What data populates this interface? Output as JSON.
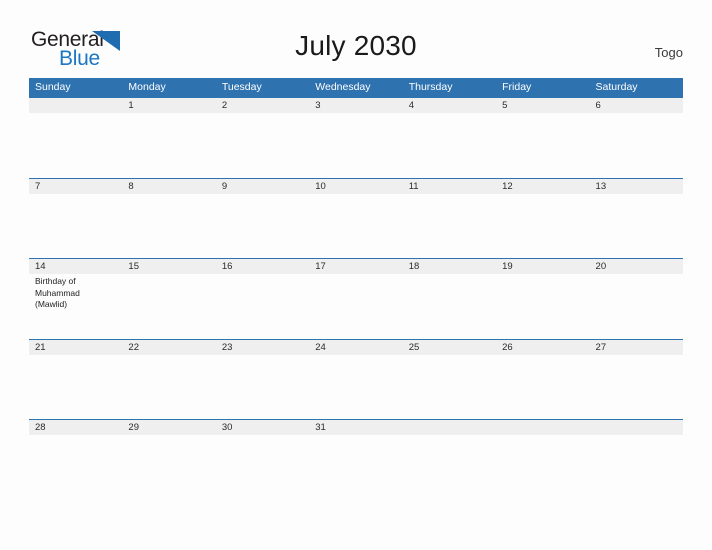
{
  "brand": {
    "word_one": "General",
    "word_two": "Blue",
    "triangle_icon": "triangle-icon",
    "accent_blue": "#1b76c4",
    "logo_dark": "#231f20"
  },
  "header": {
    "title": "July 2030",
    "country": "Togo"
  },
  "calendar": {
    "header_blue": "#2f72b0",
    "band_gray": "#efefef",
    "weekdays": [
      "Sunday",
      "Monday",
      "Tuesday",
      "Wednesday",
      "Thursday",
      "Friday",
      "Saturday"
    ],
    "weeks": [
      [
        {
          "day": ""
        },
        {
          "day": "1"
        },
        {
          "day": "2"
        },
        {
          "day": "3"
        },
        {
          "day": "4"
        },
        {
          "day": "5"
        },
        {
          "day": "6"
        }
      ],
      [
        {
          "day": "7"
        },
        {
          "day": "8"
        },
        {
          "day": "9"
        },
        {
          "day": "10"
        },
        {
          "day": "11"
        },
        {
          "day": "12"
        },
        {
          "day": "13"
        }
      ],
      [
        {
          "day": "14",
          "event": "Birthday of Muhammad (Mawlid)"
        },
        {
          "day": "15"
        },
        {
          "day": "16"
        },
        {
          "day": "17"
        },
        {
          "day": "18"
        },
        {
          "day": "19"
        },
        {
          "day": "20"
        }
      ],
      [
        {
          "day": "21"
        },
        {
          "day": "22"
        },
        {
          "day": "23"
        },
        {
          "day": "24"
        },
        {
          "day": "25"
        },
        {
          "day": "26"
        },
        {
          "day": "27"
        }
      ],
      [
        {
          "day": "28"
        },
        {
          "day": "29"
        },
        {
          "day": "30"
        },
        {
          "day": "31"
        },
        {
          "day": ""
        },
        {
          "day": ""
        },
        {
          "day": ""
        }
      ]
    ]
  }
}
